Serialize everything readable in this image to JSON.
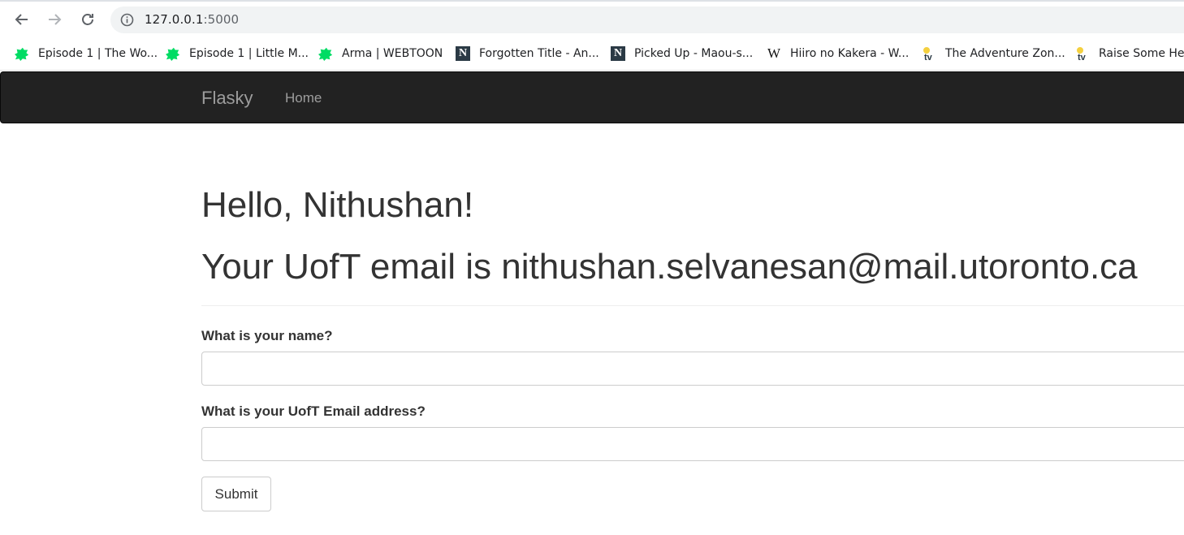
{
  "browser": {
    "url_host": "127.0.0.1",
    "url_port": ":5000",
    "icons": {
      "back": "back-arrow-icon",
      "forward": "forward-arrow-icon",
      "reload": "reload-icon",
      "info": "site-info-icon"
    }
  },
  "bookmarks": [
    {
      "label": "Episode 1 | The Wo...",
      "icon": "webtoon-icon"
    },
    {
      "label": "Episode 1 | Little M...",
      "icon": "webtoon-icon"
    },
    {
      "label": "Arma | WEBTOON",
      "icon": "webtoon-icon"
    },
    {
      "label": "Forgotten Title - An...",
      "icon": "novelupdates-icon"
    },
    {
      "label": "Picked Up - Maou-s...",
      "icon": "novelupdates-icon"
    },
    {
      "label": "Hiiro no Kakera - W...",
      "icon": "wikipedia-icon"
    },
    {
      "label": "The Adventure Zon...",
      "icon": "tv-icon"
    },
    {
      "label": "Raise Some Hel",
      "icon": "tv-icon"
    }
  ],
  "navbar": {
    "brand": "Flasky",
    "home": "Home"
  },
  "main": {
    "greeting": "Hello, Nithushan!",
    "email_line": "Your UofT email is nithushan.selvanesan@mail.utoronto.ca",
    "form": {
      "name_label": "What is your name?",
      "name_value": "",
      "email_label": "What is your UofT Email address?",
      "email_value": "",
      "submit_label": "Submit"
    }
  },
  "colors": {
    "navbar_bg": "#222222",
    "navbar_text": "#9d9d9d",
    "text": "#333333",
    "webtoon_green": "#00dc64"
  }
}
